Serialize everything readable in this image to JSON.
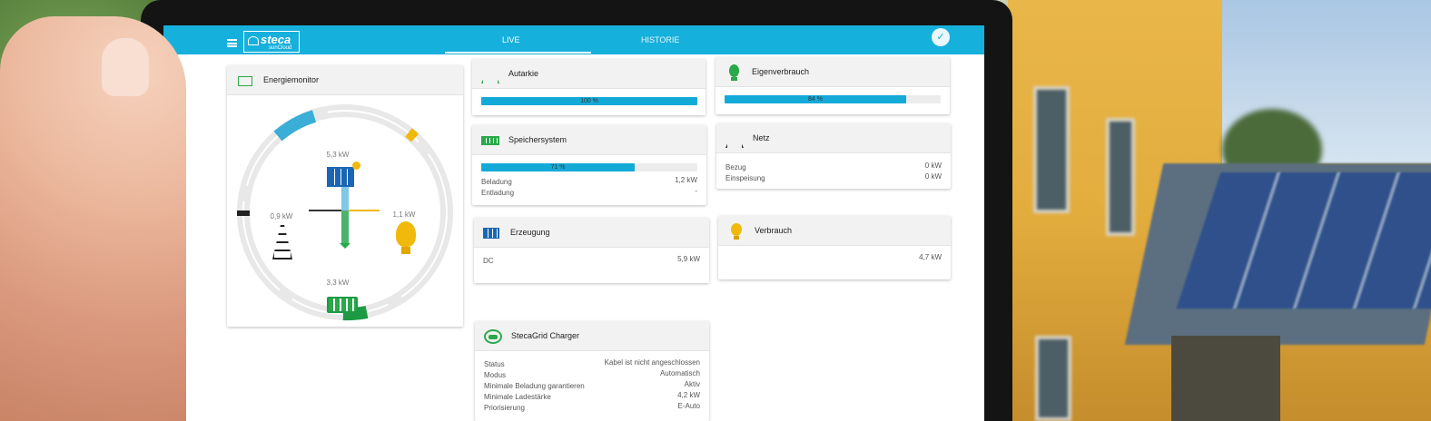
{
  "header": {
    "logo_brand": "steca",
    "logo_sub": "sunCloud",
    "tabs": [
      {
        "label": "LIVE",
        "active": true
      },
      {
        "label": "HISTORIE",
        "active": false
      }
    ]
  },
  "energiemonitor": {
    "title": "Energiemonitor",
    "pv": "5,3 kW",
    "grid": "0,9 kW",
    "consumption": "1,1 kW",
    "battery": "3,3 kW"
  },
  "autarkie": {
    "title": "Autarkie",
    "percent_label": "100 %",
    "value": 1.0
  },
  "eigenverbrauch": {
    "title": "Eigenverbrauch",
    "percent_label": "84 %",
    "value": 0.84
  },
  "speicher": {
    "title": "Speichersystem",
    "percent_label": "71 %",
    "value": 0.71,
    "rows": [
      {
        "label": "Beladung",
        "value": "1,2 kW"
      },
      {
        "label": "Entladung",
        "value": "-"
      }
    ]
  },
  "netz": {
    "title": "Netz",
    "rows": [
      {
        "label": "Bezug",
        "value": "0 kW"
      },
      {
        "label": "Einspeisung",
        "value": "0 kW"
      }
    ]
  },
  "erzeugung": {
    "title": "Erzeugung",
    "rows": [
      {
        "label": "DC",
        "value": "5,9 kW"
      }
    ]
  },
  "verbrauch": {
    "title": "Verbrauch",
    "value": "4,7 kW"
  },
  "charger": {
    "title": "StecaGrid Charger",
    "rows": [
      {
        "label": "Status",
        "value": "Kabel ist nicht angeschlossen"
      },
      {
        "label": "Modus",
        "value": "Automatisch"
      },
      {
        "label": "Minimale Beladung garantieren",
        "value": "Aktiv"
      },
      {
        "label": "Minimale Ladestärke",
        "value": "4,2 kW"
      },
      {
        "label": "Priorisierung",
        "value": "E-Auto"
      }
    ]
  },
  "colors": {
    "accent": "#16b0dc",
    "green": "#2aa84a",
    "yellow": "#f0b90b"
  }
}
